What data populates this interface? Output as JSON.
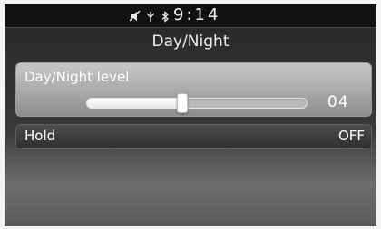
{
  "status_bar": {
    "time": "9:14",
    "icons": [
      "mute-icon",
      "phone-signal-icon",
      "bluetooth-icon"
    ]
  },
  "header": {
    "title": "Day/Night"
  },
  "day_night_level": {
    "label": "Day/Night level",
    "value_text": "04",
    "slider_fraction": 0.43
  },
  "hold": {
    "label": "Hold",
    "value": "OFF"
  },
  "colors": {
    "accent": "#ffffff",
    "panel": "#b5b5b5",
    "background": "#2a2a2a"
  }
}
